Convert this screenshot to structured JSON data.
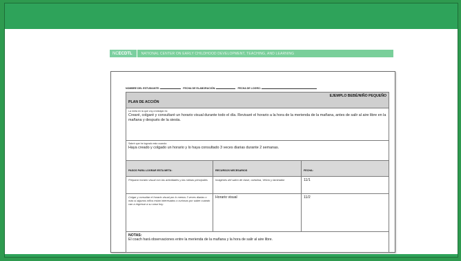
{
  "branding": {
    "logo_prefix": "NC",
    "logo_bold": "ECDTL",
    "org_name": "NATIONAL CENTER ON EARLY CHILDHOOD DEVELOPMENT, TEACHING, AND LEARNING"
  },
  "colors": {
    "brand_green": "#2ea35a",
    "brand_light_green": "#79cf9a",
    "header_gray": "#cfcfcf"
  },
  "form": {
    "student_name_label": "NOMBRE DEL ESTUDIANTE:",
    "created_date_label": "FECHA DE ELABORACIÓN:",
    "achieved_date_label": "FECHA DE LOGRO:",
    "plan_title": "PLAN DE ACCIÓN",
    "plan_example": "EJEMPLO BEBÉ/NIÑO PEQUEÑO",
    "goal_label": "La meta en la que voy a trabajar es:",
    "goal_text": "Crearé, colgaré y consultaré un horario visual durante todo el día. Revisaré el horario a la hora de la merienda de la mañana, antes de salir al aire libre en la mañana y después de la siesta.",
    "success_label": "Sabré que he logrado esto cuando:",
    "success_text": "Haya creado y colgado un horario y lo haya consultado 3 veces diarias durante 2 semanas.",
    "columns": {
      "steps": "PASOS PARA LOGRAR ESTA META:",
      "resources": "RECURSOS NECESARIOS",
      "date": "FECHA:"
    },
    "rows": [
      {
        "step": "Preparar horario visual con las actividades y las rutinas principales",
        "resources": "Imágenes del salón de clase, cartulina, Velcro y laminador",
        "date": "11/1"
      },
      {
        "step": "Colgar y consultar el horario visual por lo menos 3 veces diarias o más si algunos niños están interesados o curiosos por saber cuándo van a regresar a su casa hoy.",
        "resources": "Horario visual",
        "date": "11/2"
      }
    ],
    "notes_label": "NOTAS:",
    "notes_text": "El coach hará observaciones entre la merienda de la mañana y la hora de salir al aire libre."
  }
}
